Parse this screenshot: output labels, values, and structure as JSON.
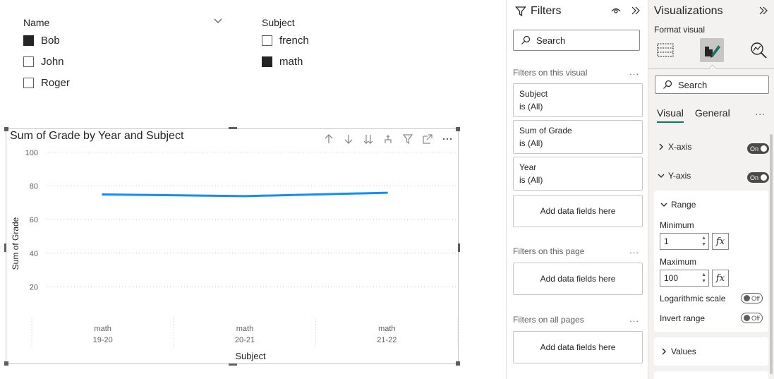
{
  "slicers": {
    "name": {
      "title": "Name",
      "items": [
        {
          "label": "Bob",
          "checked": true
        },
        {
          "label": "John",
          "checked": false
        },
        {
          "label": "Roger",
          "checked": false
        }
      ]
    },
    "subject": {
      "title": "Subject",
      "items": [
        {
          "label": "french",
          "checked": false
        },
        {
          "label": "math",
          "checked": true
        }
      ]
    }
  },
  "chart_data": {
    "type": "line",
    "title": "Sum of Grade by Year and Subject",
    "xlabel": "Subject",
    "ylabel": "Sum of Grade",
    "categories": [
      {
        "subject": "math",
        "year": "19-20"
      },
      {
        "subject": "math",
        "year": "20-21"
      },
      {
        "subject": "math",
        "year": "21-22"
      }
    ],
    "series": [
      {
        "values": [
          75,
          74,
          76
        ],
        "color": "#118dff"
      }
    ],
    "yticks": [
      20,
      40,
      60,
      80,
      100
    ],
    "ylim": [
      1,
      100
    ],
    "grid": true
  },
  "filters_pane": {
    "title": "Filters",
    "search_placeholder": "Search",
    "visual_section": "Filters on this visual",
    "visual_filters": [
      {
        "field": "Subject",
        "state": "is (All)"
      },
      {
        "field": "Sum of Grade",
        "state": "is (All)"
      },
      {
        "field": "Year",
        "state": "is (All)"
      }
    ],
    "add_fields": "Add data fields here",
    "page_section": "Filters on this page",
    "all_pages_section": "Filters on all pages",
    "more": "..."
  },
  "viz_pane": {
    "title": "Visualizations",
    "subtitle": "Format visual",
    "search_placeholder": "Search",
    "tabs": [
      "Visual",
      "General"
    ],
    "active_tab": "Visual",
    "more": "...",
    "xaxis": {
      "label": "X-axis",
      "toggle": "On"
    },
    "yaxis": {
      "label": "Y-axis",
      "toggle": "On"
    },
    "range": {
      "label": "Range",
      "min_label": "Minimum",
      "min_value": "1",
      "max_label": "Maximum",
      "max_value": "100",
      "fx": "fx",
      "log_label": "Logarithmic scale",
      "log_toggle": "Off",
      "invert_label": "Invert range",
      "invert_toggle": "Off"
    },
    "values_label": "Values"
  }
}
